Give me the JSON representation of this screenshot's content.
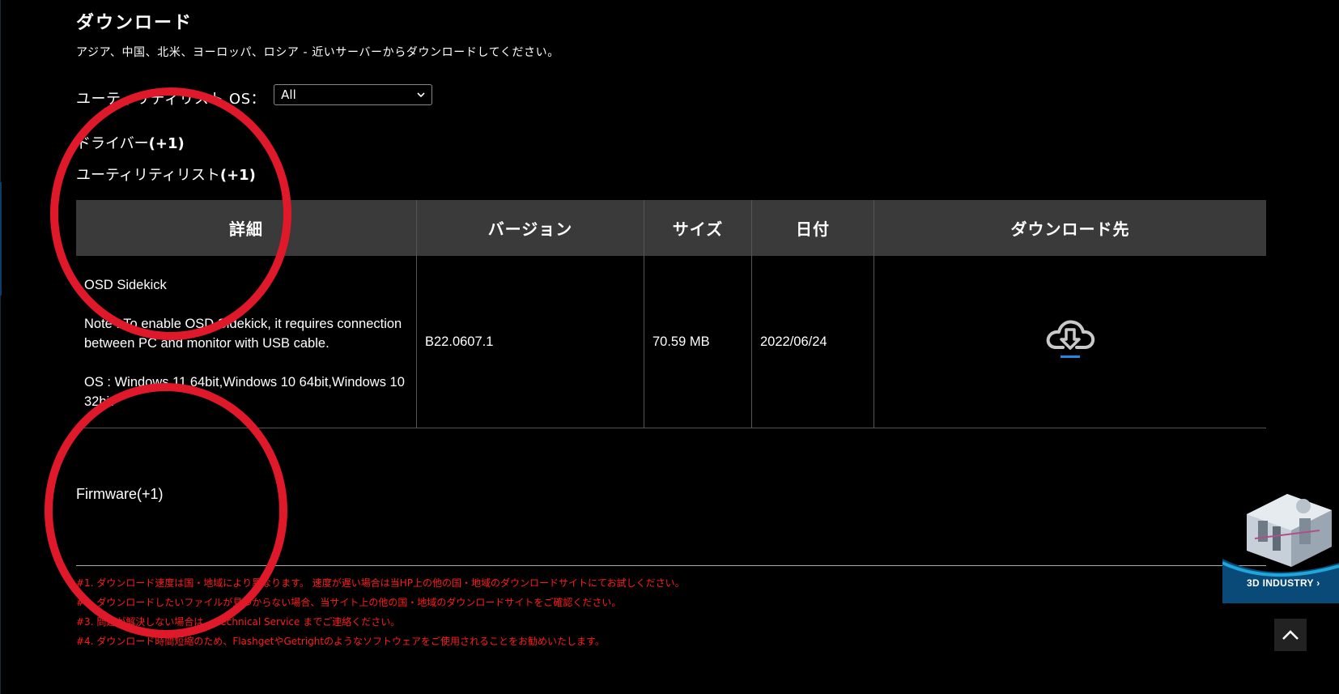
{
  "page": {
    "title": "ダウンロード",
    "subtitle": "アジア、中国、北米、ヨーロッパ、ロシア - 近いサーバーからダウンロードしてください。"
  },
  "os_filter": {
    "label": "ユーティリティリスト OS：",
    "selected": "All"
  },
  "categories": {
    "driver": {
      "label": "ドライバー",
      "count": "(+1)"
    },
    "utility": {
      "label": "ユーティリティリスト",
      "count": "(+1)"
    },
    "firmware": {
      "label": "Firmware(+1)"
    }
  },
  "table": {
    "headers": [
      "詳細",
      "バージョン",
      "サイズ",
      "日付",
      "ダウンロード先"
    ],
    "rows": [
      {
        "name": "OSD Sidekick",
        "note": "Note : To enable OSD Sidekick, it requires connection between PC and monitor with USB cable.",
        "os": "OS : Windows 11 64bit,Windows 10 64bit,Windows 10 32bit",
        "version": "B22.0607.1",
        "size": "70.59 MB",
        "date": "2022/06/24"
      }
    ]
  },
  "notes": [
    "#1. ダウンロード速度は国・地域により異なります。 速度が遅い場合は当HP上の他の国・地域のダウンロードサイトにてお試しください。",
    "#2. ダウンロードしたいファイルが見つからない場合、当サイト上の他の国・地域のダウンロードサイトをご確認ください。",
    "#3. 問題が解決しない場合は、 Technical Service までご連絡ください。",
    "#4. ダウンロード時間短縮のため、FlashgetやGetrightのようなソフトウェアをご使用されることをお勧めいたします。"
  ],
  "promo": {
    "label": "3D INDUSTRY ›"
  },
  "colors": {
    "background": "#000000",
    "header_bg": "#3a3a3a",
    "note_red": "#ff1a1a",
    "annotation_circle": "#e0192a",
    "download_accent": "#1e88e5"
  },
  "icons": {
    "select": "chevron-down-icon",
    "download": "cloud-download-icon",
    "to_top": "chevron-up-icon"
  }
}
